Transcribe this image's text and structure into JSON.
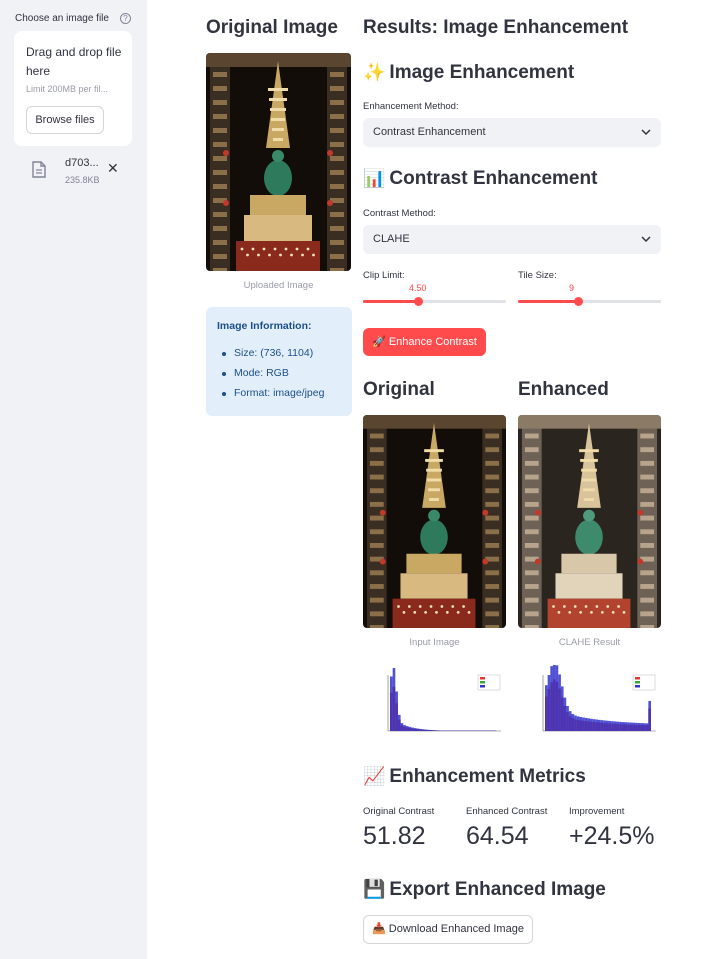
{
  "sidebar": {
    "uploader_label": "Choose an image file",
    "help_icon": "question-circle-icon",
    "dropzone_title": "Drag and drop file here",
    "dropzone_limit": "Limit 200MB per fil...",
    "browse_label": "Browse files",
    "file_name": "d703...",
    "file_size": "235.8KB"
  },
  "original_col": {
    "title": "Original Image",
    "caption": "Uploaded Image",
    "info_title": "Image Information:",
    "info_items": [
      "Size: (736, 1104)",
      "Mode: RGB",
      "Format: image/jpeg"
    ]
  },
  "results": {
    "title": "Results: Image Enhancement",
    "enh_emoji": "✨",
    "enh_heading": "Image Enhancement",
    "method_label": "Enhancement Method:",
    "method_value": "Contrast Enhancement",
    "contrast_emoji": "📊",
    "contrast_heading": "Contrast Enhancement",
    "contrast_method_label": "Contrast Method:",
    "contrast_method_value": "CLAHE",
    "clip_label": "Clip Limit:",
    "clip_value": "4.50",
    "clip_fraction": 0.385,
    "tile_label": "Tile Size:",
    "tile_value": "9",
    "tile_fraction": 0.42,
    "enhance_button": "🚀 Enhance Contrast",
    "original_sub": "Original",
    "enhanced_sub": "Enhanced",
    "input_caption": "Input Image",
    "clahe_caption": "CLAHE Result",
    "metrics_emoji": "📈",
    "metrics_heading": "Enhancement Metrics",
    "metrics": [
      {
        "label": "Original Contrast",
        "value": "51.82"
      },
      {
        "label": "Enhanced Contrast",
        "value": "64.54"
      },
      {
        "label": "Improvement",
        "value": "+24.5%"
      }
    ],
    "export_emoji": "💾",
    "export_heading": "Export Enhanced Image",
    "download_button": "📥 Download Enhanced Image"
  },
  "colors": {
    "accent": "#ff4b4b",
    "sidebar_bg": "#f0f2f6",
    "info_bg": "#e3eefb",
    "info_text": "#1c4f8c"
  }
}
